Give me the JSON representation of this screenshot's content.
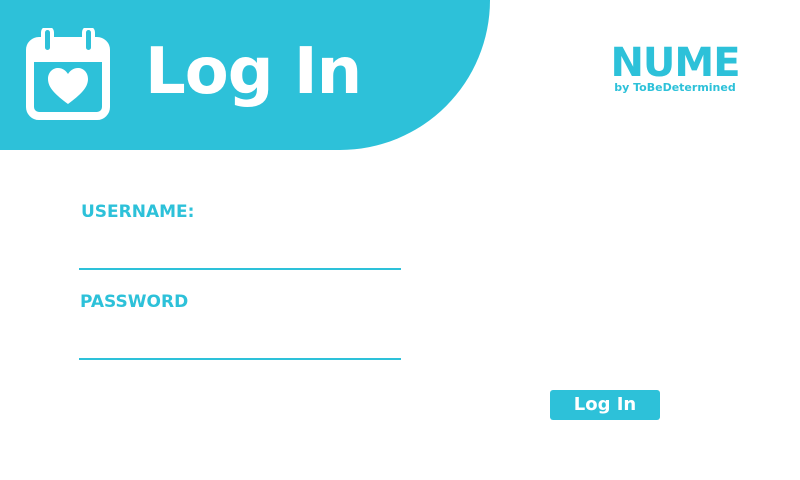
{
  "header": {
    "title": "Log In",
    "icon": "calendar-heart-icon"
  },
  "brand": {
    "name": "NUME",
    "tagline": "by ToBeDetermined"
  },
  "form": {
    "username_label": "USERNAME:",
    "username_value": "",
    "password_label": "PASSWORD",
    "password_value": "",
    "submit_label": "Log In"
  },
  "colors": {
    "accent": "#2dc1d9",
    "background": "#ffffff",
    "text_on_accent": "#ffffff"
  }
}
